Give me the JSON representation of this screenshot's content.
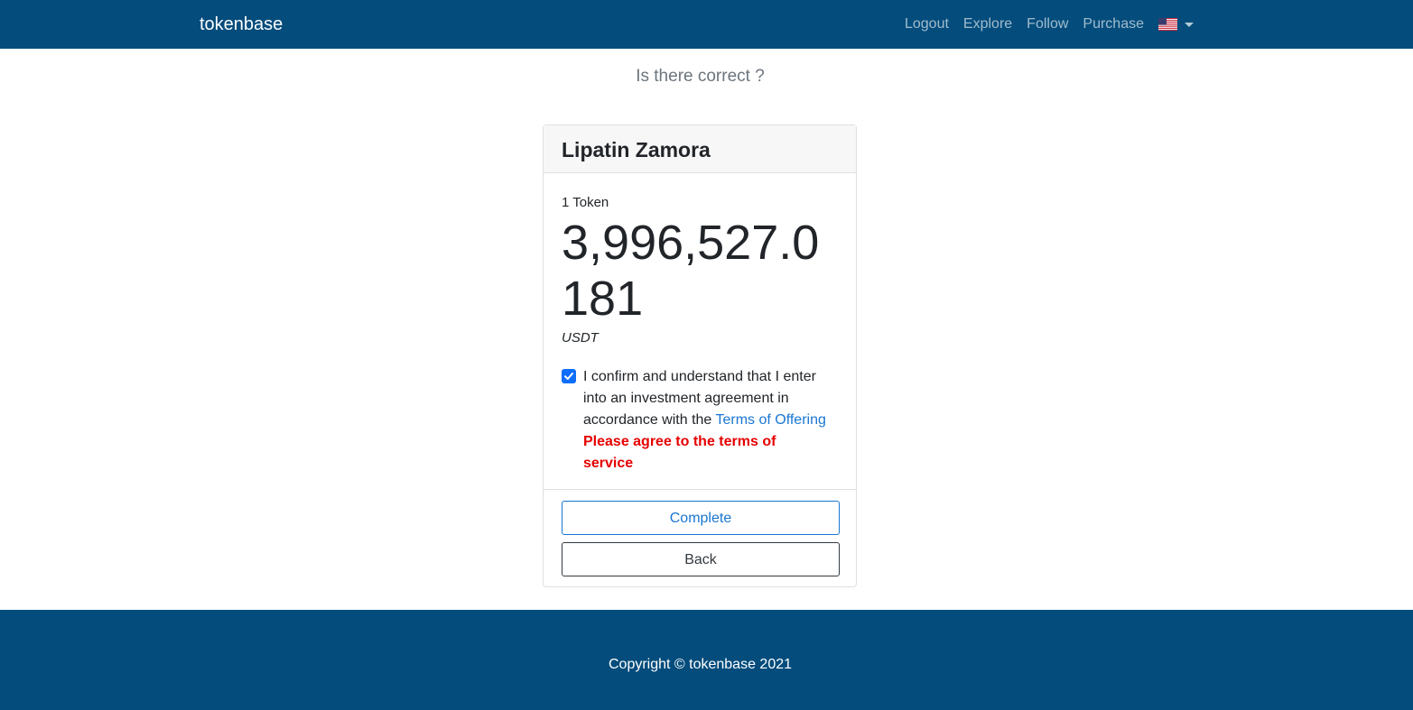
{
  "navbar": {
    "brand": "tokenbase",
    "links": [
      "Logout",
      "Explore",
      "Follow",
      "Purchase"
    ],
    "language_icon": "us-flag-icon"
  },
  "main": {
    "question": "Is there correct ?"
  },
  "card": {
    "title": "Lipatin Zamora",
    "token_label": "1 Token",
    "price": "3,996,527.0181",
    "unit": "USDT",
    "confirm_checked": true,
    "confirm_text": "I confirm and understand that I enter into an investment agreement in accordance with the",
    "terms_link": "Terms of Offering",
    "error": "Please agree to the terms of service",
    "complete_label": "Complete",
    "back_label": "Back"
  },
  "footer": {
    "copyright": "Copyright © tokenbase 2021"
  },
  "colors": {
    "navbar": "#034c7c",
    "link_blue": "#1976d2",
    "checkbox": "#0d6efd",
    "error": "#e60000"
  }
}
